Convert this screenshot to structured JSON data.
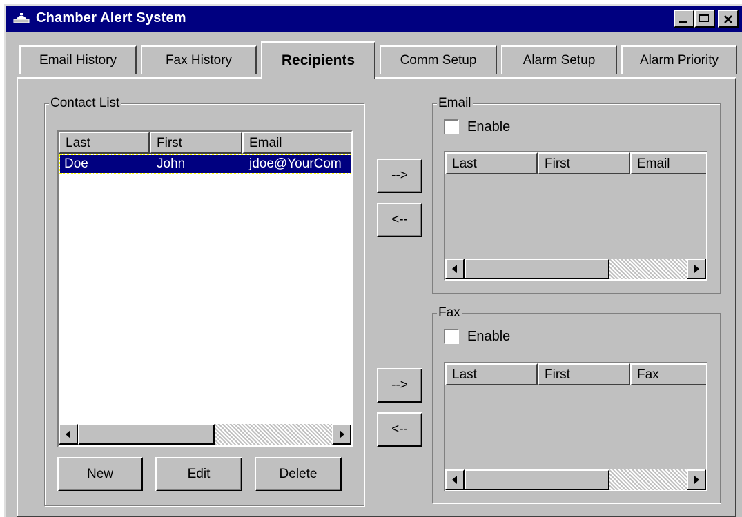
{
  "window": {
    "title": "Chamber Alert System",
    "app_icon": "bell-alarm-icon",
    "controls": [
      "minimize-icon",
      "maximize-icon",
      "close-icon"
    ]
  },
  "tabs": [
    {
      "label": "Email History"
    },
    {
      "label": "Fax History"
    },
    {
      "label": "Recipients",
      "active": true
    },
    {
      "label": "Comm Setup"
    },
    {
      "label": "Alarm Setup"
    },
    {
      "label": "Alarm Priority"
    }
  ],
  "contact_list": {
    "legend": "Contact List",
    "columns": [
      "Last",
      "First",
      "Email"
    ],
    "rows": [
      {
        "last": "Doe",
        "first": "John",
        "email": "jdoe@YourCom",
        "selected": true
      }
    ],
    "buttons": {
      "new": "New",
      "edit": "Edit",
      "delete": "Delete"
    }
  },
  "transfer_buttons": {
    "add": "-->",
    "remove": "<--"
  },
  "email_group": {
    "legend": "Email",
    "enable_label": "Enable",
    "enabled": false,
    "columns": [
      "Last",
      "First",
      "Email"
    ]
  },
  "fax_group": {
    "legend": "Fax",
    "enable_label": "Enable",
    "enabled": false,
    "columns": [
      "Last",
      "First",
      "Fax"
    ]
  },
  "colors": {
    "face": "#c0c0c0",
    "title_bar": "#000080",
    "selection": "#000080"
  }
}
